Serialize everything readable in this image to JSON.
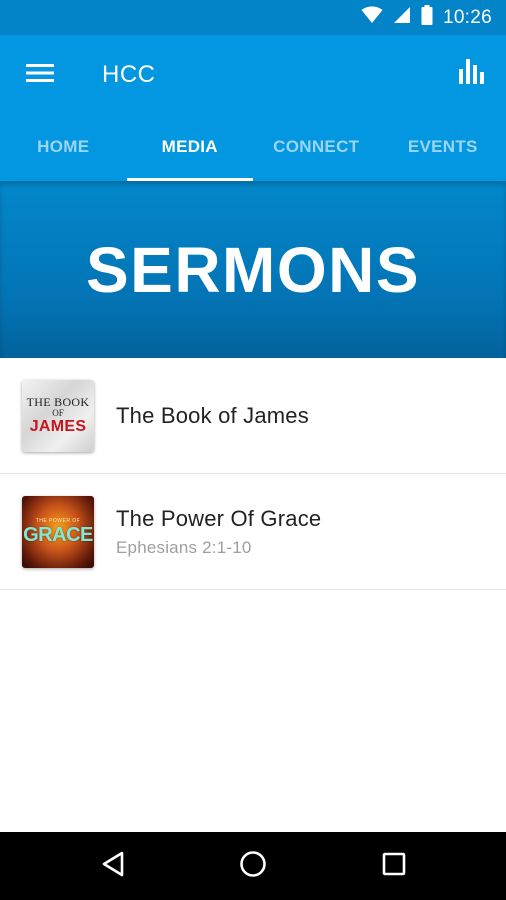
{
  "status_bar": {
    "time": "10:26",
    "icons": [
      "wifi-icon",
      "signal-icon",
      "battery-icon"
    ],
    "background": "#0383c8"
  },
  "app_bar": {
    "title": "HCC",
    "menu_icon": "hamburger-menu-icon",
    "action_icon": "bar-chart-icon",
    "background": "#0396e1"
  },
  "tabs": [
    {
      "label": "HOME",
      "active": false
    },
    {
      "label": "MEDIA",
      "active": true
    },
    {
      "label": "CONNECT",
      "active": false
    },
    {
      "label": "EVENTS",
      "active": false
    }
  ],
  "banner": {
    "title": "SERMONS"
  },
  "sermons": [
    {
      "title": "The Book of James",
      "subtitle": "",
      "thumb_lines": [
        "THE BOOK",
        "OF",
        "JAMES"
      ]
    },
    {
      "title": "The Power Of Grace",
      "subtitle": "Ephesians 2:1-10",
      "thumb_lines": [
        "THE POWER OF",
        "GRACE"
      ]
    }
  ],
  "nav_bar": {
    "icons": [
      "back-icon",
      "home-icon",
      "recents-icon"
    ]
  }
}
